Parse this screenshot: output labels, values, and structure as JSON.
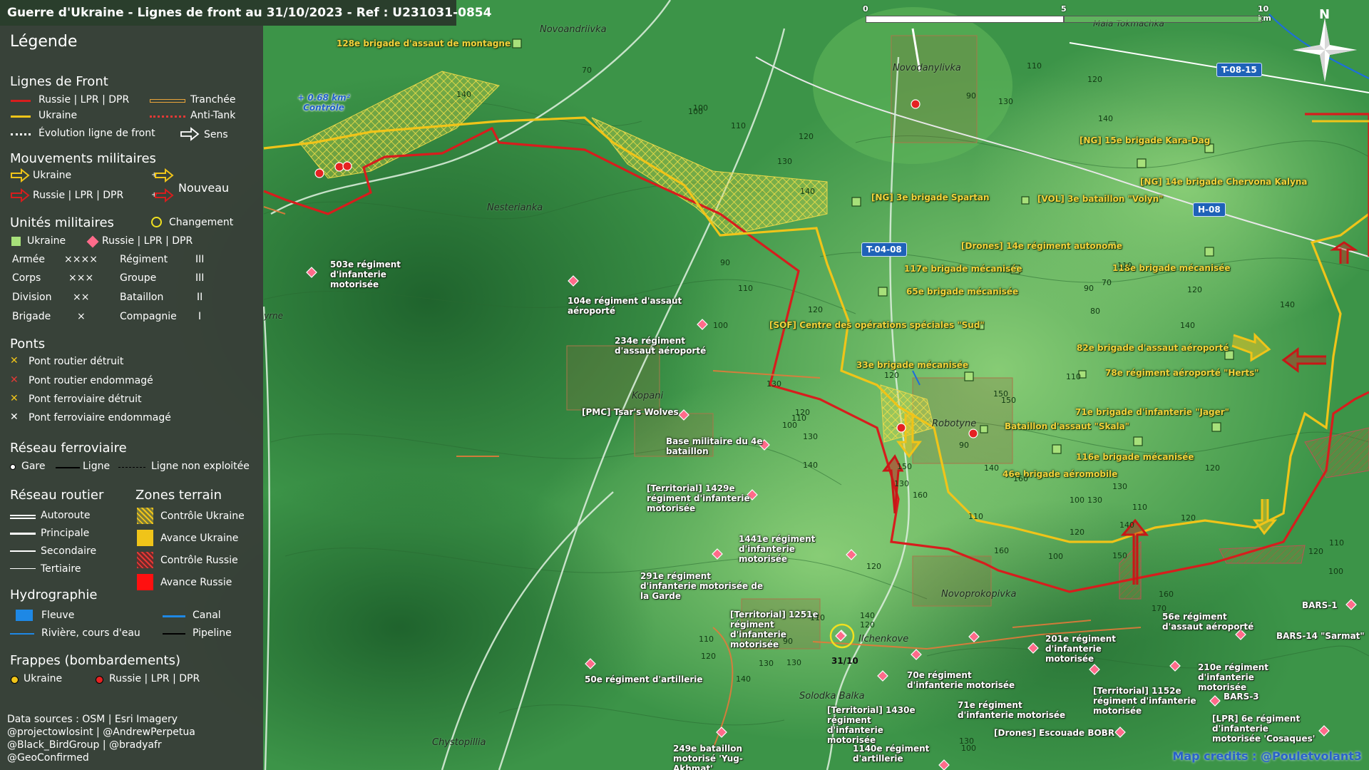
{
  "title": "Guerre d'Ukraine - Lignes de front au 31/10/2023 - Ref : U231031-0854",
  "scale": {
    "ticks": [
      "0",
      "5",
      "10 km"
    ]
  },
  "north_label": "N",
  "colors": {
    "russia": "#d71d1d",
    "ukraine": "#f0c419",
    "ukraine_units": "#a7e07a",
    "russia_units": "#ff6b8a",
    "water": "#1e88e5",
    "map_green": "#2e8b3e",
    "legend_bg": "#3a3e3a"
  },
  "legend": {
    "title": "Légende",
    "front_lines": {
      "heading": "Lignes de Front",
      "russia": "Russie | LPR | DPR",
      "ukraine": "Ukraine",
      "evolution": "Évolution ligne de front",
      "trench": "Tranchée",
      "antitank": "Anti-Tank",
      "direction": "Sens"
    },
    "movements": {
      "heading": "Mouvements militaires",
      "ukraine": "Ukraine",
      "russia": "Russie | LPR | DPR",
      "new": "Nouveau"
    },
    "units": {
      "heading": "Unités militaires",
      "change": "Changement",
      "ukraine": "Ukraine",
      "russia": "Russie | LPR | DPR",
      "rows": [
        {
          "left": "Armée",
          "left_sym": "××××",
          "right": "Régiment",
          "right_sym": "III"
        },
        {
          "left": "Corps",
          "left_sym": "×××",
          "right": "Groupe",
          "right_sym": "III"
        },
        {
          "left": "Division",
          "left_sym": "××",
          "right": "Bataillon",
          "right_sym": "II"
        },
        {
          "left": "Brigade",
          "left_sym": "×",
          "right": "Compagnie",
          "right_sym": "I"
        }
      ]
    },
    "bridges": {
      "heading": "Ponts",
      "items": [
        {
          "label": "Pont routier détruit",
          "color": "#f0c419"
        },
        {
          "label": "Pont routier endommagé",
          "color": "#e53935"
        },
        {
          "label": "Pont ferroviaire détruit",
          "color": "#f0c419"
        },
        {
          "label": "Pont ferroviaire endommagé",
          "color": "#ffffff"
        }
      ]
    },
    "rail": {
      "heading": "Réseau ferroviaire",
      "station": "Gare",
      "line": "Ligne",
      "unused": "Ligne non exploitée"
    },
    "roads": {
      "heading": "Réseau routier",
      "items": [
        "Autoroute",
        "Principale",
        "Secondaire",
        "Tertiaire"
      ]
    },
    "zones": {
      "heading": "Zones terrain",
      "items": [
        "Contrôle Ukraine",
        "Avance Ukraine",
        "Contrôle Russie",
        "Avance Russie"
      ]
    },
    "hydro": {
      "heading": "Hydrographie",
      "river_big": "Fleuve",
      "canal": "Canal",
      "river": "Rivière, cours d'eau",
      "pipeline": "Pipeline"
    },
    "strikes": {
      "heading": "Frappes (bombardements)",
      "ukraine": "Ukraine",
      "russia": "Russie | LPR | DPR"
    },
    "sources": [
      "Data sources : OSM | Esri Imagery",
      "@projectowlosint | @AndrewPerpetua",
      "@Black_BirdGroup | @bradyafr",
      "@GeoConfirmed"
    ]
  },
  "places": [
    {
      "id": "novoandriivka",
      "name": "Novoandriivka"
    },
    {
      "id": "novodanylivka",
      "name": "Novodanylivka"
    },
    {
      "id": "nesterianka",
      "name": "Nesterianka"
    },
    {
      "id": "kopani",
      "name": "Kopani"
    },
    {
      "id": "robotyne",
      "name": "Robotyne"
    },
    {
      "id": "novoprokopivka",
      "name": "Novoprokopivka"
    },
    {
      "id": "ilchenkove",
      "name": "Ilchenkove"
    },
    {
      "id": "solodka-balka",
      "name": "Solodka Balka"
    },
    {
      "id": "chystopillia",
      "name": "Chystopillia"
    },
    {
      "id": "mala-tokmachka",
      "name": "Mala Tokmachka"
    },
    {
      "id": "pyrne",
      "name": "yrne"
    }
  ],
  "road_badges": [
    "T-08-15",
    "H-08",
    "T-04-08"
  ],
  "annotation": "+ 0.68 km²\nContrôle",
  "date_marker": "31/10",
  "ukraine_units": [
    "128e brigade d'assaut de montagne",
    "[NG] 15e brigade Kara-Dag",
    "[NG] 14e brigade Chervona Kalyna",
    "[NG] 3e brigade Spartan",
    "[VOL] 3e bataillon \"Volyn\"",
    "[Drones] 14e régiment autonome",
    "117e brigade mécanisée",
    "118e brigade mécanisée",
    "65e brigade mécanisée",
    "[SOF] Centre des opérations spéciales \"Sud\"",
    "82e brigade d'assaut aéroporté",
    "33e brigade mécanisée",
    "78e régiment aéroporté \"Herts\"",
    "71e brigade d'infanterie \"Jager\"",
    "Bataillon d'assaut \"Skala\"",
    "116e brigade mécanisée",
    "46e brigade aéromobile"
  ],
  "russia_units": [
    "503e régiment d'infanterie motorisée",
    "104e régiment d'assaut aéroporté",
    "234e régiment d'assaut aéroporté",
    "[PMC] Tsar's Wolves",
    "Base militaire du 4e bataillon",
    "[Territorial] 1429e régiment d'infanterie motorisée",
    "1441e régiment d'infanterie motorisée",
    "291e régiment d'infanterie motorisée de la Garde",
    "[Territorial] 1251e régiment d'infanterie motorisée",
    "50e régiment d'artillerie",
    "70e régiment d'infanterie motorisée",
    "201e régiment d'infanterie motorisée",
    "71e régiment d'infanterie motorisée",
    "[Territorial] 1152e régiment d'infanterie motorisée",
    "[Territorial] 1430e régiment d'infanterie motorisée",
    "249e bataillon motorisé 'Yug-Akhmat'",
    "1140e régiment d'artillerie",
    "[Drones] Escouade BOBR",
    "56e régiment d'assaut aéroporté",
    "BARS-1",
    "BARS-14 \"Sarmat\"",
    "210e régiment d'infanterie motorisée",
    "BARS-3",
    "[LPR] 6e régiment d'infanterie motorisée 'Cosaques'"
  ],
  "elevations": [
    "70",
    "140",
    "100",
    "110",
    "120",
    "130",
    "140",
    "90",
    "110",
    "120",
    "130",
    "100",
    "140",
    "90",
    "110",
    "100",
    "120",
    "130",
    "120",
    "110",
    "100",
    "90",
    "120",
    "130",
    "100",
    "70",
    "90",
    "110",
    "120",
    "140",
    "80",
    "110",
    "140",
    "150",
    "160",
    "140",
    "150",
    "160",
    "120",
    "130",
    "140",
    "130",
    "120",
    "110",
    "100",
    "140",
    "120",
    "130",
    "160",
    "150",
    "110",
    "120",
    "90",
    "110",
    "120",
    "130",
    "140",
    "130",
    "140",
    "110",
    "120",
    "100",
    "130",
    "150",
    "170",
    "160",
    "120",
    "110",
    "100"
  ],
  "credits": "Map credits : @Pouletvolant3"
}
